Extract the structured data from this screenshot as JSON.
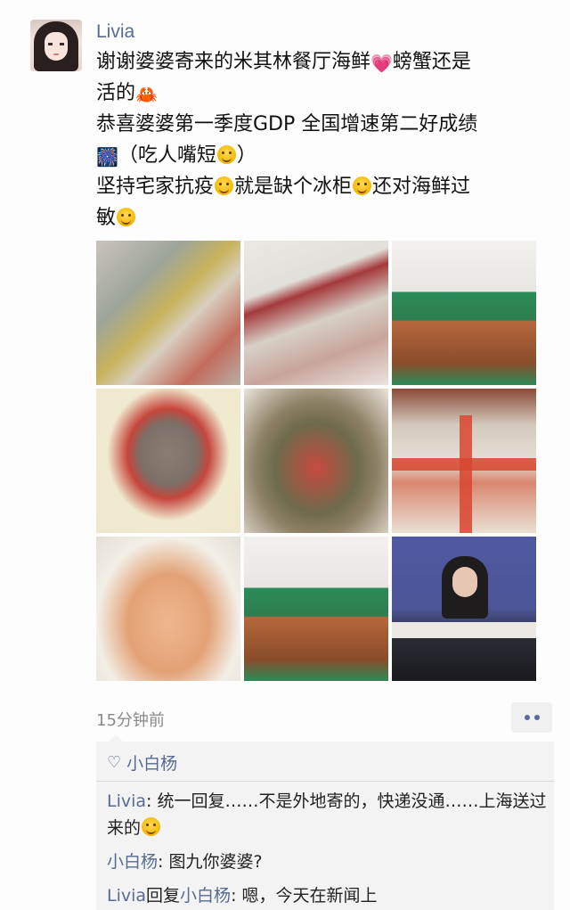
{
  "post": {
    "username": "Livia",
    "lines": [
      {
        "t1": "谢谢婆婆寄来的米其林餐厅海鲜",
        "e1": "💗",
        "t2": "螃蟹还是"
      },
      {
        "t1": "活的",
        "e1": "🦀",
        "t2": ""
      },
      {
        "t1": "恭喜婆婆第一季度GDP 全国增速第二好成绩",
        "e1": "",
        "t2": ""
      },
      {
        "t1": "",
        "e1": "🎆",
        "t2": "（吃人嘴短"
      },
      {
        "t1": "坚持宅家抗疫",
        "e1": "",
        "t2": "就是缺个冰柜"
      },
      {
        "t1": "还对海鲜过",
        "e1": "",
        "t2": ""
      },
      {
        "t1": "敏",
        "e1": "",
        "t2": ""
      }
    ],
    "closing_paren": "）",
    "timestamp": "15分钟前"
  },
  "photos": [
    {
      "name": "fish"
    },
    {
      "name": "meat-and-fish"
    },
    {
      "name": "milk-and-coffee"
    },
    {
      "name": "crab-single"
    },
    {
      "name": "crabs-group"
    },
    {
      "name": "boxed-package"
    },
    {
      "name": "shrimp"
    },
    {
      "name": "milk-and-coffee-2"
    },
    {
      "name": "news-conference"
    }
  ],
  "comments": {
    "likes_user": "小白杨",
    "items": [
      {
        "author": "Livia",
        "sep": ": ",
        "text": "统一回复……不是外地寄的，快递没通……上海送过来的"
      },
      {
        "author": "小白杨",
        "sep": ": ",
        "text": "图九你婆婆?"
      },
      {
        "author": "Livia",
        "reply_word": "回复",
        "reply_to": "小白杨",
        "sep": ": ",
        "text": "嗯，今天在新闻上"
      }
    ]
  },
  "icons": {
    "heart": "heart-outline-icon",
    "more": "more-dots-icon"
  },
  "colors": {
    "link": "#576b95",
    "comment_bg": "#f3f3f3"
  }
}
